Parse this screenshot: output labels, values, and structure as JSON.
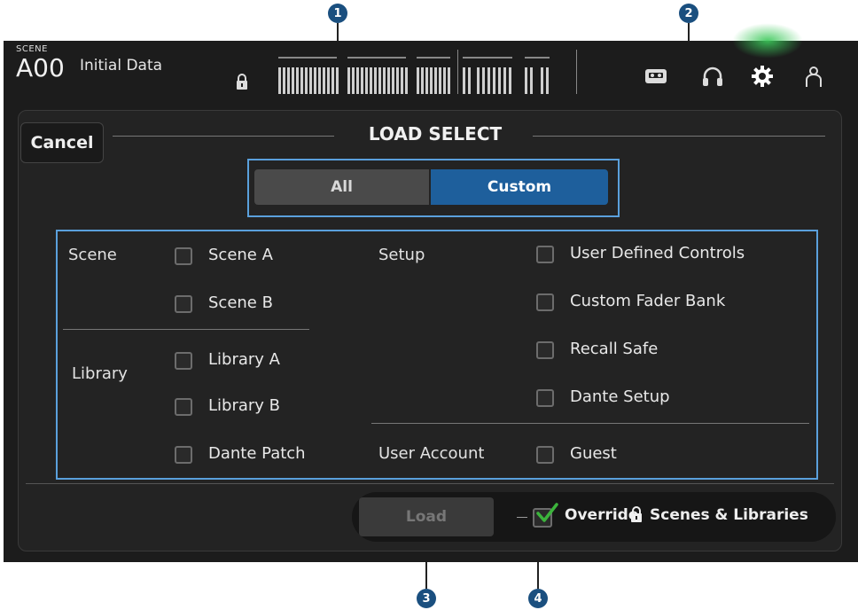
{
  "callouts": [
    "1",
    "2",
    "3",
    "4"
  ],
  "topbar": {
    "scene_small": "SCENE",
    "scene_number": "A00",
    "scene_name": "Initial Data"
  },
  "dialog": {
    "cancel_label": "Cancel",
    "title": "LOAD SELECT",
    "mode_all": "All",
    "mode_custom": "Custom",
    "selected_mode": "Custom"
  },
  "sections": {
    "scene": {
      "label": "Scene",
      "items": [
        "Scene A",
        "Scene B"
      ]
    },
    "library": {
      "label": "Library",
      "items": [
        "Library A",
        "Library B",
        "Dante Patch"
      ]
    },
    "setup": {
      "label": "Setup",
      "items": [
        "User Defined Controls",
        "Custom Fader Bank",
        "Recall Safe",
        "Dante Setup"
      ]
    },
    "user_account": {
      "label": "User Account",
      "items": [
        "Guest"
      ]
    }
  },
  "footer": {
    "load_label": "Load",
    "override_text1": "Override",
    "override_text2": "Scenes & Libraries",
    "override_checked": true
  },
  "colors": {
    "accent": "#1e5f9c",
    "highlight": "#5aa0dc",
    "check": "#3cb43c",
    "callout": "#1a4f7f"
  }
}
